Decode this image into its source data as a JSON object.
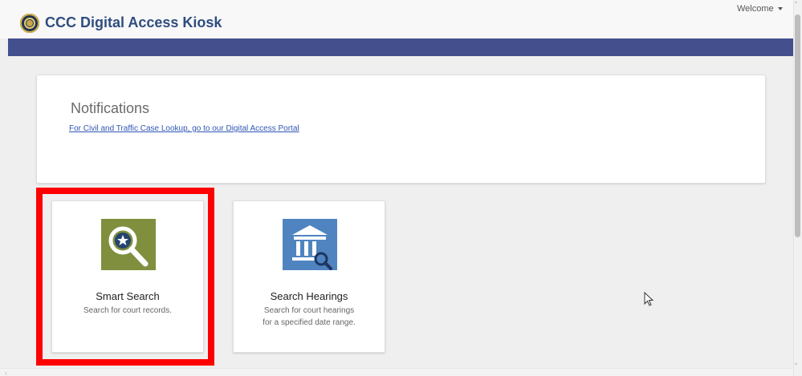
{
  "header": {
    "app_title": "CCC Digital Access Kiosk",
    "welcome_label": "Welcome",
    "logo_icon": "court-seal-icon"
  },
  "notifications": {
    "title": "Notifications",
    "link_text": "For Civil and Traffic Case Lookup, go to our Digital Access Portal"
  },
  "tiles": [
    {
      "id": "smart-search",
      "title": "Smart Search",
      "description_lines": [
        "Search for court records."
      ],
      "icon": "magnifier-star-icon",
      "icon_color": "#7f8f3e",
      "selected": true
    },
    {
      "id": "search-hearings",
      "title": "Search Hearings",
      "description_lines": [
        "Search for court hearings",
        "for a specified date range."
      ],
      "icon": "courthouse-search-icon",
      "icon_color": "#4f84c1",
      "selected": false
    }
  ],
  "colors": {
    "brand_blue": "#2f4d7f",
    "nav_bar": "#43508d",
    "selection_highlight": "#ff0000",
    "page_background": "#efefef"
  }
}
